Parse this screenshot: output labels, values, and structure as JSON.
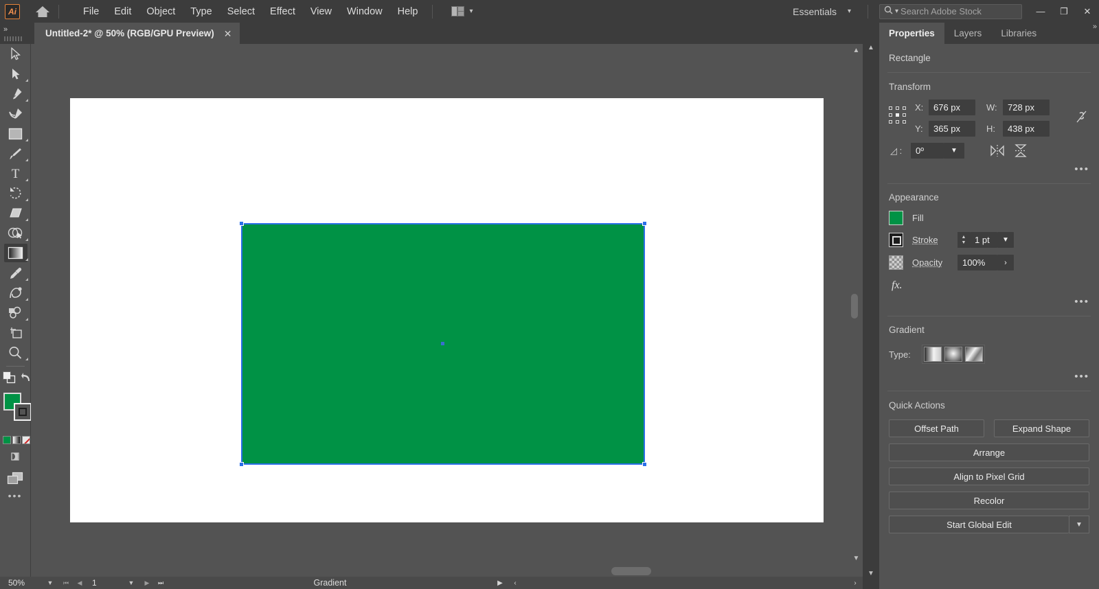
{
  "app": {
    "logo_text": "Ai",
    "home_icon": "home-icon",
    "arrange_icon": "arrange-documents-icon"
  },
  "menubar": {
    "items": [
      {
        "label": "File"
      },
      {
        "label": "Edit"
      },
      {
        "label": "Object"
      },
      {
        "label": "Type"
      },
      {
        "label": "Select"
      },
      {
        "label": "Effect"
      },
      {
        "label": "View"
      },
      {
        "label": "Window"
      },
      {
        "label": "Help"
      }
    ],
    "workspace": "Essentials",
    "search_placeholder": "Search Adobe Stock",
    "window_controls": {
      "minimize": "—",
      "restore": "❐",
      "close": "✕"
    }
  },
  "tabbar": {
    "document_title": "Untitled-2* @ 50% (RGB/GPU Preview)",
    "close_label": "✕",
    "expand_arrows": "»",
    "right_arrows": "»"
  },
  "toolbar": {
    "tools": [
      {
        "name": "selection-tool",
        "active": false,
        "has_flyout": false
      },
      {
        "name": "direct-selection-tool",
        "active": false,
        "has_flyout": true
      },
      {
        "name": "pen-tool",
        "active": false,
        "has_flyout": true
      },
      {
        "name": "curvature-tool",
        "active": false,
        "has_flyout": false
      },
      {
        "name": "rectangle-tool",
        "active": false,
        "has_flyout": true
      },
      {
        "name": "paintbrush-tool",
        "active": false,
        "has_flyout": true
      },
      {
        "name": "type-tool",
        "active": false,
        "has_flyout": true
      },
      {
        "name": "rotate-tool",
        "active": false,
        "has_flyout": true
      },
      {
        "name": "eraser-tool",
        "active": false,
        "has_flyout": true
      },
      {
        "name": "shape-builder-tool",
        "active": false,
        "has_flyout": true
      },
      {
        "name": "gradient-tool",
        "active": true,
        "has_flyout": true
      },
      {
        "name": "eyedropper-tool",
        "active": false,
        "has_flyout": true
      },
      {
        "name": "blend-tool",
        "active": false,
        "has_flyout": true
      },
      {
        "name": "symbol-sprayer-tool",
        "active": false,
        "has_flyout": true
      },
      {
        "name": "artboard-tool",
        "active": false,
        "has_flyout": false
      },
      {
        "name": "zoom-tool",
        "active": false,
        "has_flyout": true
      }
    ],
    "swatches": {
      "fill_color": "#009245",
      "stroke_color": "#1d1d1d",
      "color_modes": [
        "color-swatch",
        "gradient-swatch",
        "none-swatch"
      ]
    },
    "more_options": "•••"
  },
  "canvas": {
    "artboard_background": "#ffffff",
    "shape": {
      "name": "rectangle",
      "fill": "#009245",
      "selection_color": "#2b6fe8"
    }
  },
  "statusbar": {
    "zoom": "50%",
    "page": "1",
    "status_text": "Gradient",
    "first_label": "⏮",
    "prev_label": "◀",
    "next_label": "▶",
    "last_label": "⏭",
    "play_label": "▶",
    "left_arrow": "‹",
    "right_arrow": "›"
  },
  "properties": {
    "tabs": [
      {
        "label": "Properties",
        "active": true
      },
      {
        "label": "Layers",
        "active": false
      },
      {
        "label": "Libraries",
        "active": false
      }
    ],
    "object_type": "Rectangle",
    "transform": {
      "title": "Transform",
      "x_label": "X:",
      "x_value": "676 px",
      "y_label": "Y:",
      "y_value": "365 px",
      "w_label": "W:",
      "w_value": "728 px",
      "h_label": "H:",
      "h_value": "438 px",
      "angle_label": "◿ :",
      "angle_value": "0º",
      "link_icon": "unlink-icon",
      "flip_horizontal_icon": "flip-horizontal-icon",
      "flip_vertical_icon": "flip-vertical-icon",
      "more_icon": "•••"
    },
    "appearance": {
      "title": "Appearance",
      "fill_label": "Fill",
      "fill_color": "#009245",
      "stroke_label": "Stroke",
      "stroke_width": "1 pt",
      "opacity_label": "Opacity",
      "opacity_value": "100%",
      "fx_label": "fx.",
      "more_icon": "•••"
    },
    "gradient": {
      "title": "Gradient",
      "type_label": "Type:",
      "types": [
        "linear-gradient-icon",
        "radial-gradient-icon",
        "freeform-gradient-icon"
      ],
      "more_icon": "•••"
    },
    "quick_actions": {
      "title": "Quick Actions",
      "buttons": [
        {
          "label": "Offset Path"
        },
        {
          "label": "Expand Shape"
        },
        {
          "label": "Arrange"
        },
        {
          "label": "Align to Pixel Grid"
        },
        {
          "label": "Recolor"
        },
        {
          "label": "Start Global Edit"
        }
      ],
      "dropdown_icon": "chevron-down-icon"
    }
  }
}
